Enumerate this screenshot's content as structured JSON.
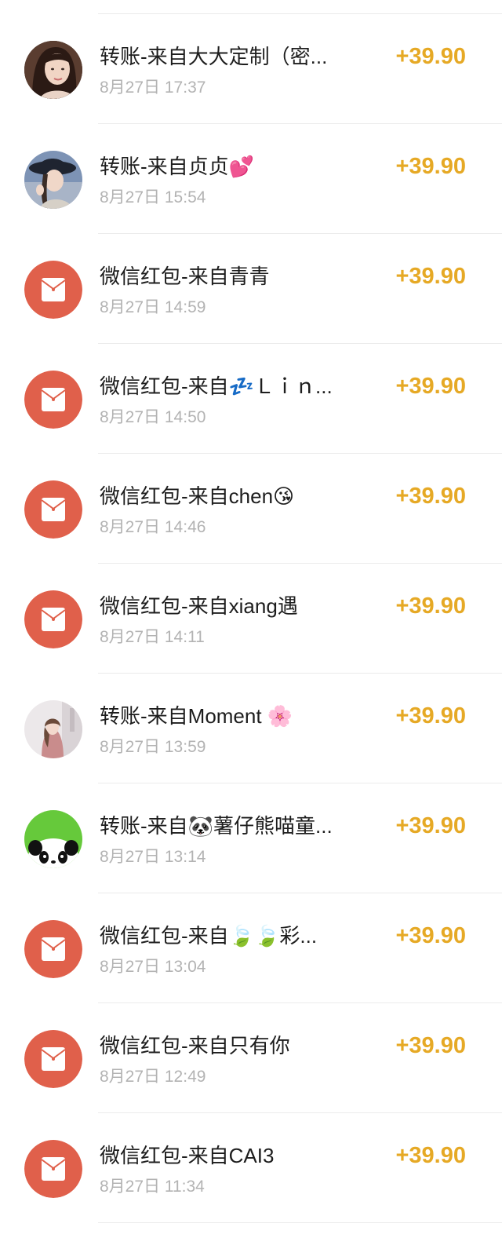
{
  "records": [
    {
      "kind": "transfer",
      "avatar": "avatar-photo-woman-long-hair",
      "title": "转账-来自大大定制（密...",
      "time": "8月27日 17:37",
      "amount": "+39.90"
    },
    {
      "kind": "transfer",
      "avatar": "avatar-photo-woman-hat",
      "title": "转账-来自贞贞💕",
      "time": "8月27日 15:54",
      "amount": "+39.90"
    },
    {
      "kind": "red-packet",
      "avatar": "red-packet-icon",
      "title": "微信红包-来自青青",
      "time": "8月27日 14:59",
      "amount": "+39.90"
    },
    {
      "kind": "red-packet",
      "avatar": "red-packet-icon",
      "title": "微信红包-来自💤Ｌｉｎ...",
      "time": "8月27日 14:50",
      "amount": "+39.90"
    },
    {
      "kind": "red-packet",
      "avatar": "red-packet-icon",
      "title": "微信红包-来自chen😘",
      "time": "8月27日 14:46",
      "amount": "+39.90"
    },
    {
      "kind": "red-packet",
      "avatar": "red-packet-icon",
      "title": "微信红包-来自xiang遇",
      "time": "8月27日 14:11",
      "amount": "+39.90"
    },
    {
      "kind": "transfer",
      "avatar": "avatar-photo-woman-indoor",
      "title": "转账-来自Moment 🌸",
      "time": "8月27日 13:59",
      "amount": "+39.90"
    },
    {
      "kind": "transfer",
      "avatar": "avatar-panda",
      "title": "转账-来自🐼薯仔熊喵童...",
      "time": "8月27日 13:14",
      "amount": "+39.90"
    },
    {
      "kind": "red-packet",
      "avatar": "red-packet-icon",
      "title": "微信红包-来自🍃🍃彩...",
      "time": "8月27日 13:04",
      "amount": "+39.90"
    },
    {
      "kind": "red-packet",
      "avatar": "red-packet-icon",
      "title": "微信红包-来自只有你",
      "time": "8月27日 12:49",
      "amount": "+39.90"
    },
    {
      "kind": "red-packet",
      "avatar": "red-packet-icon",
      "title": "微信红包-来自CAI3",
      "time": "8月27日 11:34",
      "amount": "+39.90"
    }
  ],
  "colors": {
    "amount": "#e6a925",
    "red_packet_bg": "#e0604b",
    "title": "#1d1d1d",
    "time": "#b3b3b3",
    "divider": "#ebebeb"
  }
}
